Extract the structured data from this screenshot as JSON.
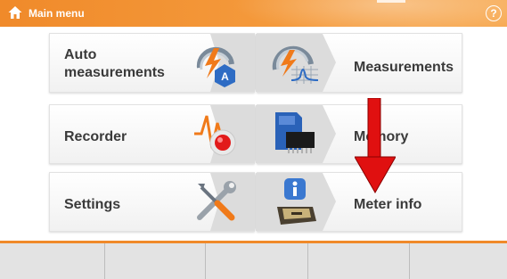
{
  "header": {
    "title": "Main menu",
    "help_symbol": "?",
    "home_icon": "home-icon",
    "help_icon": "help-icon",
    "accent_color": "#f08a2a"
  },
  "tiles": [
    {
      "label": "Auto\nmeasurements",
      "icon": "auto-measurement-icon"
    },
    {
      "label": "Measurements",
      "icon": "measurement-gauge-icon"
    },
    {
      "label": "Recorder",
      "icon": "recorder-icon"
    },
    {
      "label": "Memory",
      "icon": "memory-card-icon"
    },
    {
      "label": "Settings",
      "icon": "tools-icon"
    },
    {
      "label": "Meter info",
      "icon": "meter-info-icon"
    }
  ],
  "softkeys": [
    "",
    "",
    "",
    "",
    ""
  ],
  "overlay": {
    "annotation": "red-down-arrow",
    "color": "#e01010"
  }
}
